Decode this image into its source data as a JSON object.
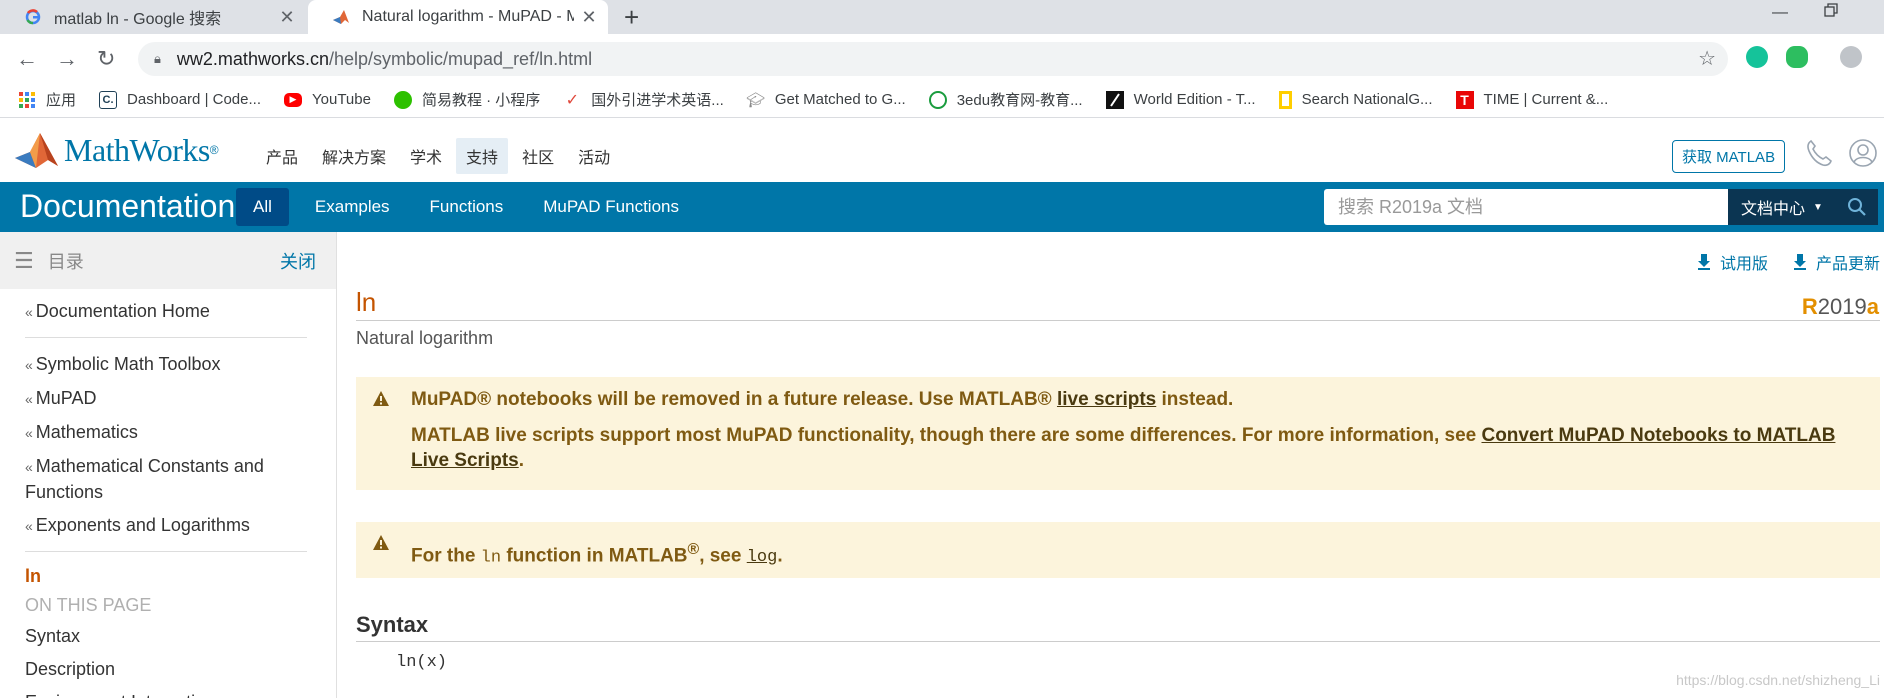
{
  "browser": {
    "tabs": [
      {
        "title": "matlab ln - Google 搜索",
        "active": false
      },
      {
        "title": "Natural logarithm - MuPAD - M",
        "active": true
      }
    ],
    "url_host": "ww2.mathworks.cn",
    "url_path": "/help/symbolic/mupad_ref/ln.html",
    "bookmarks": [
      {
        "label": "应用",
        "icon": "apps-grid-icon"
      },
      {
        "label": "Dashboard | Code...",
        "icon": "codecademy-icon"
      },
      {
        "label": "YouTube",
        "icon": "youtube-icon"
      },
      {
        "label": "简易教程 · 小程序",
        "icon": "wechat-icon"
      },
      {
        "label": "国外引进学术英语...",
        "icon": "check-icon"
      },
      {
        "label": "Get Matched to G...",
        "icon": "graduation-cap-icon"
      },
      {
        "label": "3edu教育网-教育...",
        "icon": "3edu-icon"
      },
      {
        "label": "World Edition - T...",
        "icon": "ft-icon"
      },
      {
        "label": "Search NationalG...",
        "icon": "natgeo-icon"
      },
      {
        "label": "TIME | Current &...",
        "icon": "time-icon"
      }
    ]
  },
  "mw_header": {
    "logo_text": "MathWorks",
    "logo_reg": "®",
    "nav": [
      "产品",
      "解决方案",
      "学术",
      "支持",
      "社区",
      "活动"
    ],
    "get_matlab": "获取 MATLAB"
  },
  "doc_bar": {
    "title": "Documentation",
    "tabs": [
      "All",
      "Examples",
      "Functions",
      "MuPAD Functions"
    ],
    "search_placeholder": "搜索 R2019a 文档",
    "scope": "文档中心"
  },
  "sidebar": {
    "header_label": "目录",
    "close_label": "关闭",
    "home_link": "Documentation Home",
    "breadcrumbs": [
      "Symbolic Math Toolbox",
      "MuPAD",
      "Mathematics",
      "Mathematical Constants and Functions",
      "Exponents and Logarithms"
    ],
    "current": "ln",
    "on_this_page": "ON THIS PAGE",
    "page_links": [
      "Syntax",
      "Description",
      "Environment Interactions"
    ]
  },
  "main": {
    "top_links": [
      "试用版",
      "产品更新"
    ],
    "title": "ln",
    "release_first": "R",
    "release_mid": "2019",
    "release_last": "a",
    "purpose": "Natural logarithm",
    "alert1": {
      "line1_prefix": "MuPAD® notebooks will be removed in a future release. Use MATLAB® ",
      "line1_link": "live scripts",
      "line1_suffix": " instead.",
      "line2_prefix": "MATLAB live scripts support most MuPAD functionality, though there are some differences. For more information, see ",
      "line2_link": "Convert MuPAD Notebooks to MATLAB Live Scripts",
      "line2_suffix": "."
    },
    "alert2": {
      "prefix": "For the ",
      "code": "ln",
      "mid": " function in MATLAB",
      "sup": "®",
      "mid2": ", see ",
      "link_code": "log",
      "suffix": "."
    },
    "syntax_heading": "Syntax",
    "syntax_code": "ln(x)",
    "watermark": "https://blog.csdn.net/shizheng_Li"
  },
  "colors": {
    "doc_bar": "#0076a8",
    "active_tab": "#004b87",
    "accent_orange": "#c45400",
    "alert_bg": "#fcf4dc",
    "alert_text": "#7f5a12"
  }
}
